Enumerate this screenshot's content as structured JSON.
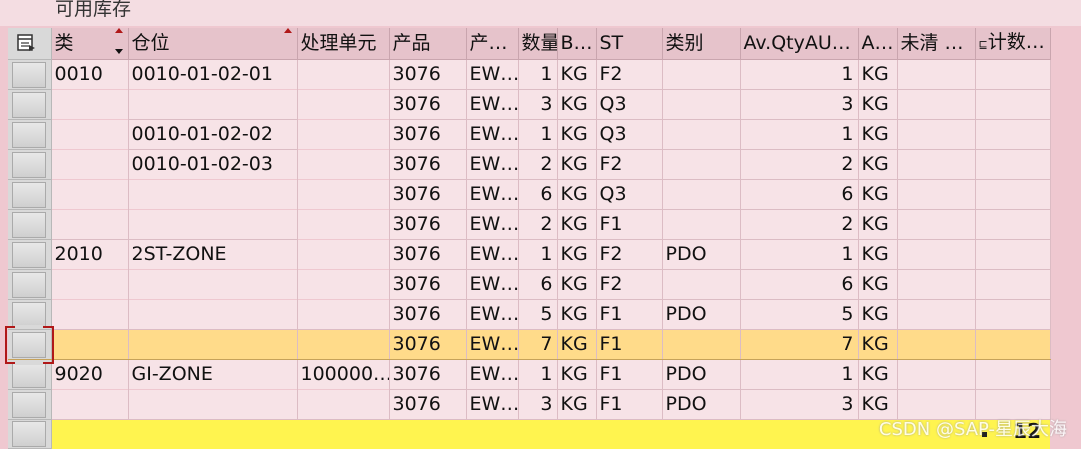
{
  "window": {
    "title": "可用库存"
  },
  "grid": {
    "columns": [
      "类",
      "仓位",
      "处理单元",
      "产品",
      "产…",
      "数量",
      "B…",
      "ST",
      "类别",
      "Av.QtyAU…",
      "A…",
      "未清 …",
      "计数…"
    ],
    "rows": [
      [
        "0010",
        "0010-01-02-01",
        "",
        "3076",
        "EW…",
        "1",
        "KG",
        "F2",
        "",
        "1",
        "KG",
        "",
        ""
      ],
      [
        "",
        "",
        "",
        "3076",
        "EW…",
        "3",
        "KG",
        "Q3",
        "",
        "3",
        "KG",
        "",
        ""
      ],
      [
        "",
        "0010-01-02-02",
        "",
        "3076",
        "EW…",
        "1",
        "KG",
        "Q3",
        "",
        "1",
        "KG",
        "",
        ""
      ],
      [
        "",
        "0010-01-02-03",
        "",
        "3076",
        "EW…",
        "2",
        "KG",
        "F2",
        "",
        "2",
        "KG",
        "",
        ""
      ],
      [
        "",
        "",
        "",
        "3076",
        "EW…",
        "6",
        "KG",
        "Q3",
        "",
        "6",
        "KG",
        "",
        ""
      ],
      [
        "",
        "",
        "",
        "3076",
        "EW…",
        "2",
        "KG",
        "F1",
        "",
        "2",
        "KG",
        "",
        ""
      ],
      [
        "2010",
        "2ST-ZONE",
        "",
        "3076",
        "EW…",
        "1",
        "KG",
        "F2",
        "PDO",
        "1",
        "KG",
        "",
        ""
      ],
      [
        "",
        "",
        "",
        "3076",
        "EW…",
        "6",
        "KG",
        "F2",
        "",
        "6",
        "KG",
        "",
        ""
      ],
      [
        "",
        "",
        "",
        "3076",
        "EW…",
        "5",
        "KG",
        "F1",
        "PDO",
        "5",
        "KG",
        "",
        ""
      ],
      [
        "",
        "",
        "",
        "3076",
        "EW…",
        "7",
        "KG",
        "F1",
        "",
        "7",
        "KG",
        "",
        ""
      ],
      [
        "9020",
        "GI-ZONE",
        "100000…",
        "3076",
        "EW…",
        "1",
        "KG",
        "F1",
        "PDO",
        "1",
        "KG",
        "",
        ""
      ],
      [
        "",
        "",
        "",
        "3076",
        "EW…",
        "3",
        "KG",
        "F1",
        "PDO",
        "3",
        "KG",
        "",
        ""
      ]
    ],
    "highlighted_row": 9,
    "total": "12"
  },
  "watermark": "CSDN @SAP-星辰大海",
  "colors": {
    "row_bg": "#f7e3e7",
    "highlight": "#ffdb8a",
    "total_bar": "#fff44f",
    "header_bg": "#e6c3cb"
  }
}
